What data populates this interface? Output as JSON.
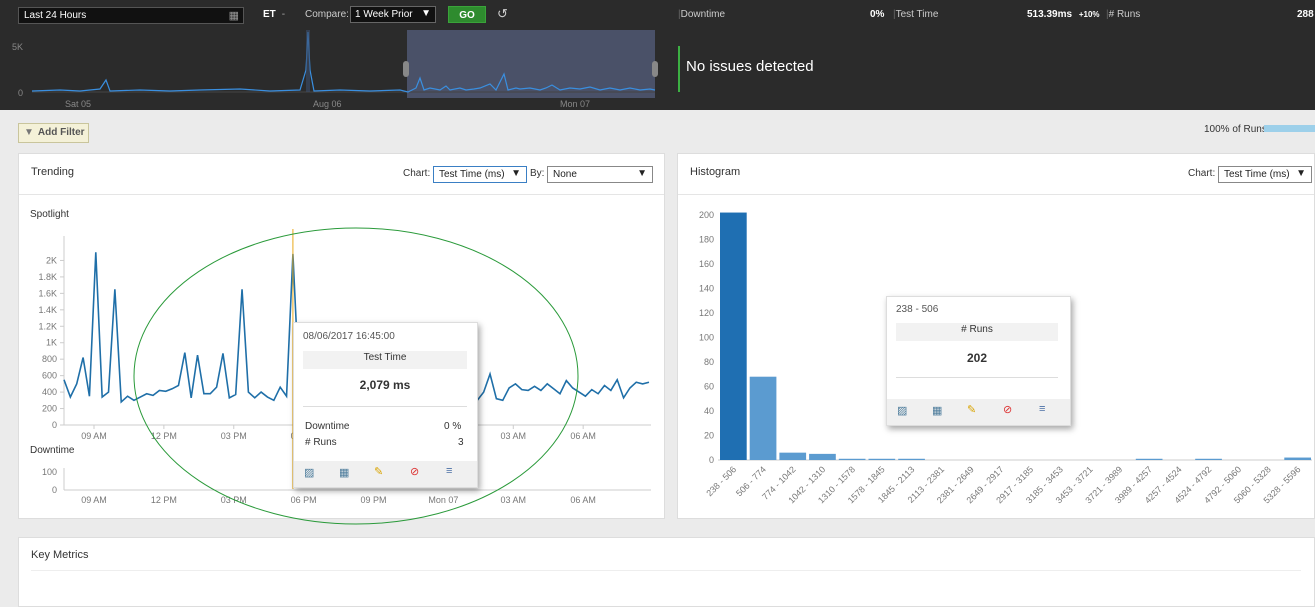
{
  "toolbar": {
    "time_range": "Last 24 Hours",
    "timezone": "ET",
    "compare_label": "Compare:",
    "compare_value": "1 Week Prior",
    "go_label": "GO",
    "downtime_label": "Downtime",
    "downtime_value": "0%",
    "test_time_label": "Test Time",
    "test_time_value": "513.39ms",
    "test_time_delta": "+10%",
    "runs_label": "# Runs",
    "runs_value": "288"
  },
  "overview": {
    "y_labels": [
      "5K",
      "0"
    ],
    "x_labels": [
      "Sat 05",
      "Aug 06",
      "Mon 07"
    ],
    "status_text": "No issues detected",
    "status_color": "#3cb043"
  },
  "filters": {
    "add_filter_label": "Add Filter",
    "runs_pct_label": "100% of Runs:"
  },
  "trending": {
    "title": "Trending",
    "chart_label": "Chart:",
    "chart_value": "Test Time (ms)",
    "by_label": "By:",
    "by_value": "None",
    "spotlight_label": "Spotlight",
    "downtime_label": "Downtime"
  },
  "tooltip_trend": {
    "timestamp": "08/06/2017 16:45:00",
    "metric_label": "Test Time",
    "metric_value": "2,079 ms",
    "downtime_label": "Downtime",
    "downtime_value": "0 %",
    "runs_label": "# Runs",
    "runs_value": "3"
  },
  "histogram": {
    "title": "Histogram",
    "chart_label": "Chart:",
    "chart_value": "Test Time (ms)"
  },
  "tooltip_hist": {
    "range": "238 - 506",
    "metric_label": "# Runs",
    "metric_value": "202"
  },
  "key_metrics": {
    "title": "Key Metrics"
  },
  "chart_data": [
    {
      "type": "line",
      "name": "Spotlight",
      "x_tick_labels": [
        "09 AM",
        "12 PM",
        "03 PM",
        "06 PM",
        "09 PM",
        "Mon 07",
        "03 AM",
        "06 AM"
      ],
      "y_tick_labels": [
        "0",
        "200",
        "400",
        "600",
        "800",
        "1K",
        "1.2K",
        "1.4K",
        "1.6K",
        "1.8K",
        "2K"
      ],
      "ylim": [
        0,
        2200
      ],
      "values": [
        550,
        340,
        500,
        820,
        350,
        2100,
        340,
        400,
        1650,
        280,
        350,
        300,
        340,
        380,
        360,
        420,
        410,
        440,
        480,
        880,
        330,
        850,
        380,
        380,
        460,
        870,
        330,
        370,
        1650,
        400,
        330,
        400,
        340,
        300,
        460,
        350,
        2079,
        450,
        380,
        400,
        420,
        350,
        500,
        380,
        420,
        360,
        400,
        380,
        340,
        360,
        420,
        480,
        650,
        400,
        460,
        380,
        700,
        500,
        470,
        440,
        450,
        600,
        370,
        420,
        550,
        300,
        400,
        620,
        320,
        300,
        450,
        500,
        430,
        420,
        470,
        420,
        500,
        440,
        380,
        540,
        450,
        400,
        350,
        430,
        380,
        480,
        420,
        550,
        330,
        450,
        520,
        500,
        520
      ],
      "downtime_y_ticks": [
        "0",
        "100"
      ]
    },
    {
      "type": "bar",
      "name": "Histogram",
      "categories": [
        "238 - 506",
        "506 - 774",
        "774 - 1042",
        "1042 - 1310",
        "1310 - 1578",
        "1578 - 1845",
        "1845 - 2113",
        "2113 - 2381",
        "2381 - 2649",
        "2649 - 2917",
        "2917 - 3185",
        "3185 - 3453",
        "3453 - 3721",
        "3721 - 3989",
        "3989 - 4257",
        "4257 - 4524",
        "4524 - 4792",
        "4792 - 5060",
        "5060 - 5328",
        "5328 - 5596"
      ],
      "values": [
        202,
        68,
        6,
        5,
        1,
        1,
        1,
        0,
        0,
        0,
        0,
        0,
        0,
        0,
        1,
        0,
        1,
        0,
        0,
        2
      ],
      "y_tick_labels": [
        "0",
        "20",
        "40",
        "60",
        "80",
        "100",
        "120",
        "140",
        "160",
        "180",
        "200"
      ],
      "ylim": [
        0,
        200
      ],
      "colors": {
        "selected": "#1f6fb2",
        "default": "#5b9bd0"
      }
    }
  ]
}
